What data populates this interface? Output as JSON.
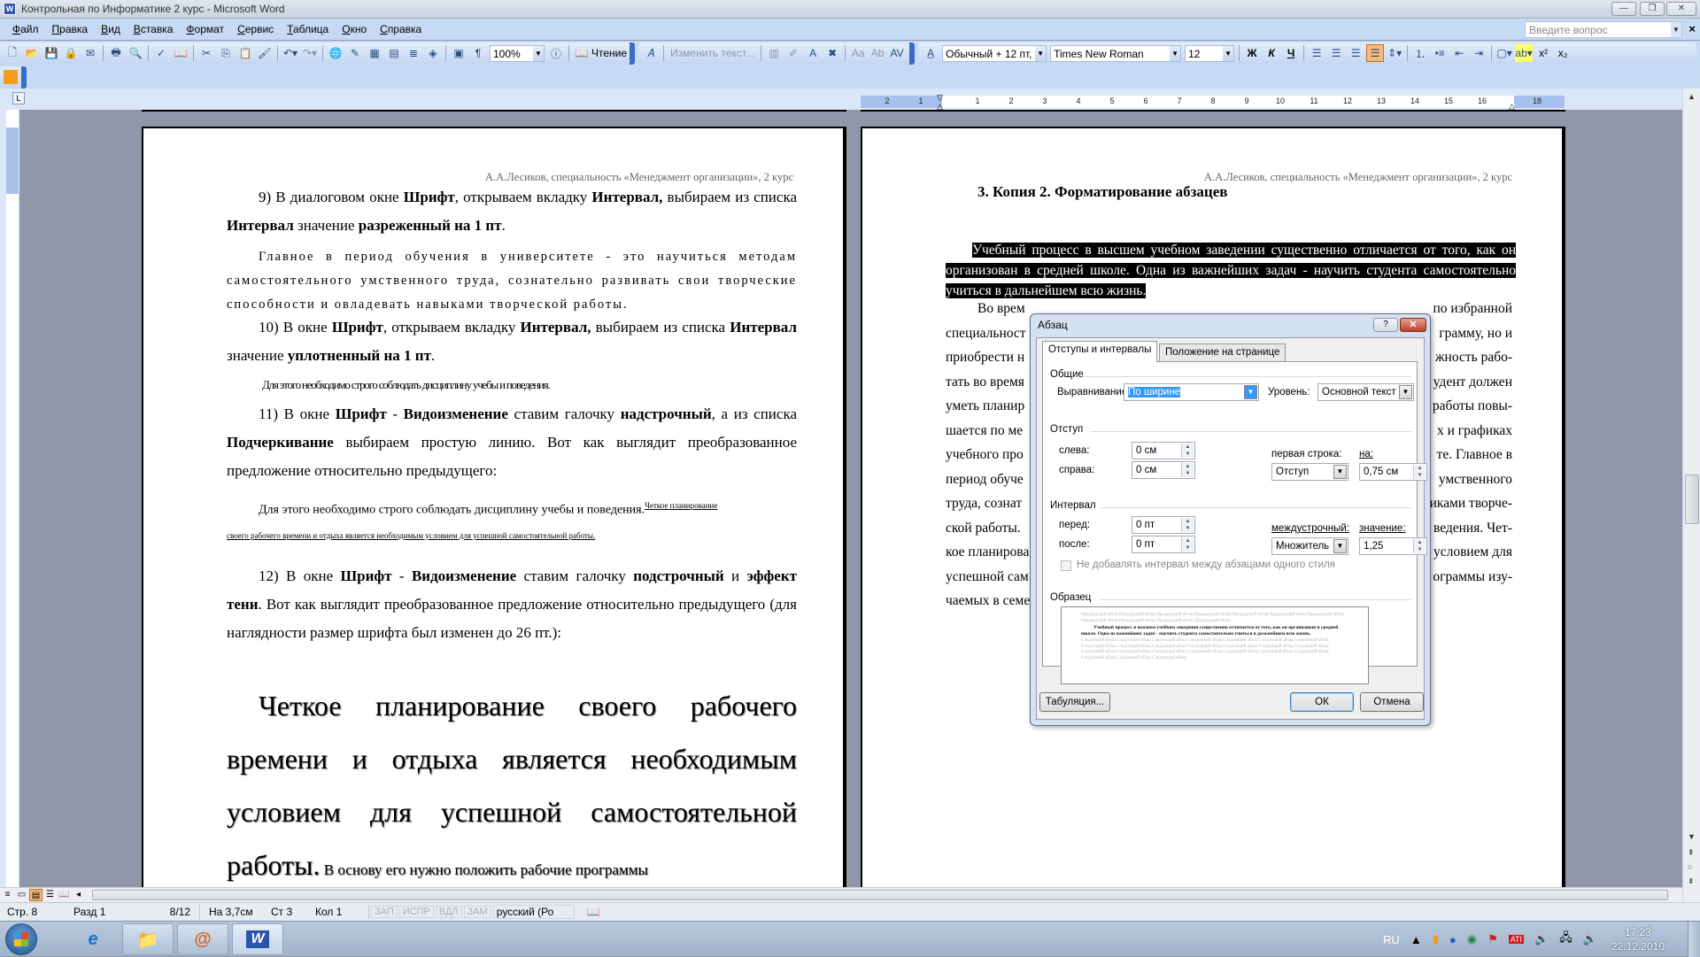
{
  "window": {
    "title": "Контрольная по Информатике  2 курс - Microsoft Word",
    "app_icon": "word-icon",
    "controls": {
      "minimize": "—",
      "restore": "❐",
      "close": "✕"
    }
  },
  "menu": {
    "items": [
      "Файл",
      "Правка",
      "Вид",
      "Вставка",
      "Формат",
      "Сервис",
      "Таблица",
      "Окно",
      "Справка"
    ],
    "help_placeholder": "Введите вопрос",
    "help_close": "×"
  },
  "toolbar": {
    "zoom": "100%",
    "reading": "Чтение",
    "edit_text": "Изменить текст...",
    "style": "Обычный + 12 пт,",
    "font": "Times New Roman",
    "size": "12",
    "bold": "Ж",
    "italic": "К",
    "underline": "Ч"
  },
  "ruler": {
    "ticks": [
      "2",
      "1",
      "1",
      "2",
      "3",
      "4",
      "5",
      "6",
      "7",
      "8",
      "9",
      "10",
      "11",
      "12",
      "13",
      "14",
      "15",
      "16",
      "18"
    ]
  },
  "left_page": {
    "header": "А.А.Лесиков, специальность «Менеджмент организации», 2 курс",
    "p9_a": "9) В диалоговом окне ",
    "p9_b": "Шрифт",
    "p9_c": ", открываем вкладку ",
    "p9_d": "Интервал,",
    "p9_e": " выбираем из списка ",
    "p9_f": "Интервал",
    "p9_g": " значение ",
    "p9_h": "разреженный на 1 пт",
    "p9_i": ".",
    "spaced_text": "Главное в период обучения в университете - это научиться методам самостоятельного умственного труда, сознательно развивать свои творческие способности и овладевать навыками творческой работы.",
    "p10_a": "10) В  окне ",
    "p10_b": "Шрифт",
    "p10_c": ", открываем вкладку ",
    "p10_d": "Интервал,",
    "p10_e": " выбираем из списка ",
    "p10_f": "Интервал",
    "p10_g": " значение ",
    "p10_h": "уплотненный на 1 пт",
    "p10_i": ".",
    "condensed_text": "Для этого необходимо строго соблюдать дисциплину учебы и поведения.",
    "p11_a": "11) В окне  ",
    "p11_b": "Шрифт",
    "p11_c": " - ",
    "p11_d": "Видоизменение",
    "p11_e": " ставим галочку ",
    "p11_f": "надстрочный",
    "p11_g": ", а из списка ",
    "p11_h": "Подчеркивание",
    "p11_i": " выбираем простую линию. Вот как выглядит преобразованное предложение относительно предыдущего:",
    "sample11_a": "Для этого необходимо строго соблюдать дисциплину учебы и поведения.",
    "sample11_sup": "Четкое планирование",
    "sample11_b": "своего рабочего времени и отдыха является необходимым условием для успешной самостоятельной работы.",
    "p12_a": "12)  В окне  ",
    "p12_b": "Шрифт",
    "p12_c": " - ",
    "p12_d": "Видоизменение",
    "p12_e": " ставим галочку ",
    "p12_f": "подстрочный",
    "p12_g": " и ",
    "p12_h": "эффект тени",
    "p12_i": ". Вот как выглядит преобразованное предложение относительно предыдущего (для наглядности размер шрифта был изменен до 26 пт.):",
    "big_text": "Четкое планирование своего рабочего времени и отдыха является необходимым условием для успешной самостоятельной работы.",
    "big_tail": " В основу его нужно положить рабочие программы"
  },
  "right_page": {
    "header": "А.А.Лесиков, специальность «Менеджмент организации», 2 курс",
    "heading": "3. Копия 2. Форматирование абзацев",
    "selected_text": "Учебный процесс в высшем учебном заведении существенно отличается от того, как он организован в средней школе. Одна из важнейших задач - научить студента самостоятельно учиться в дальнейшем всю жизнь.",
    "left_fragments": [
      "Во врем",
      "специальност",
      "приобрести н",
      "тать во время",
      "уметь планир",
      "шается по ме",
      "учебного про",
      "период обуче",
      "труда, сознат",
      "ской работы.",
      "кое планирова",
      "успешной сам",
      "чаемых в семе"
    ],
    "right_fragments": [
      "по избранной",
      "грамму, но и",
      "жность рабо-",
      "удент должен",
      "работы повы-",
      "х и графиках",
      "те. Главное в",
      "умственного",
      "иками творче-",
      "ведения. Чет-",
      "условием для",
      "ограммы изу-",
      ""
    ]
  },
  "dialog": {
    "title": "Абзац",
    "help": "?",
    "close": "✕",
    "tabs": [
      "Отступы и интервалы",
      "Положение на странице"
    ],
    "general_group": "Общие",
    "alignment_label": "Выравнивание:",
    "alignment_value": "По ширине",
    "level_label": "Уровень:",
    "level_value": "Основной текст",
    "indent_group": "Отступ",
    "left_label": "слева:",
    "left_value": "0 см",
    "right_label": "справа:",
    "right_value": "0 см",
    "first_line_label": "первая строка:",
    "first_line_value": "Отступ",
    "by_label": "на:",
    "by_value": "0,75 см",
    "spacing_group": "Интервал",
    "before_label": "перед:",
    "before_value": "0 пт",
    "after_label": "после:",
    "after_value": "0 пт",
    "line_spacing_label": "междустрочный:",
    "line_spacing_value": "Множитель",
    "at_label": "значение:",
    "at_value": "1,25",
    "no_space_checkbox": "Не добавлять интервал между абзацами одного стиля",
    "preview_group": "Образец",
    "preview_prev": "Предыдущий абзац Предыдущий абзац Предыдущий абзац Предыдущий абзац Предыдущий абзац Предыдущий абзац Предыдущий абзац Предыдущий абзац Предыдущий абзац Предыдущий абзац Предыдущий абзац",
    "preview_cur": "Учебный процесс в высшем учебном заведении существенно отличается от того, как он организован в средней школе. Одна из важнейших задач - научить студента самостоятельно учиться в дальнейшем всю жизнь.",
    "preview_next": "Следующий абзац Следующий абзац Следующий абзац Следующий абзац Следующий абзац Следующий абзац Следующий абзац Следующий абзац Следующий абзац Следующий абзац Следующий абзац Следующий абзац Следующий абзац Следующий абзац Следующий абзац Следующий абзац Следующий абзац Следующий абзац Следующий абзац Следующий абзац Следующий абзац Следующий абзац Следующий абзац Следующий абзац",
    "tabs_button": "Табуляция...",
    "ok_button": "ОК",
    "cancel_button": "Отмена"
  },
  "statusbar": {
    "page": "Стр. 8",
    "section": "Разд 1",
    "pages": "8/12",
    "at": "На 3,7см",
    "line": "Ст 3",
    "col": "Кол 1",
    "rec": "ЗАП",
    "trk": "ИСПР",
    "ext": "ВДЛ",
    "ovr": "ЗАМ",
    "language": "русский (Ро"
  },
  "taskbar": {
    "lang": "RU",
    "time": "17:23",
    "date": "22.12.2010"
  },
  "colors": {
    "toolbar_bg": "#c6d9f5",
    "doc_bg": "#9097aa",
    "active_button": "#f9b97a",
    "selection": "#000000"
  }
}
